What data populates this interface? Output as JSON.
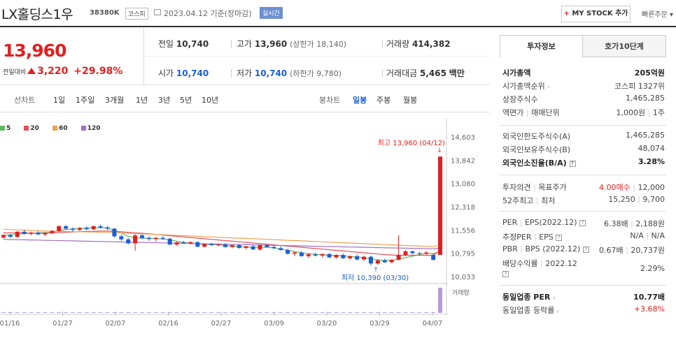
{
  "header": {
    "title": "LX홀딩스1우",
    "code": "38380K",
    "market": "코스피",
    "date_text": "2023.04.12  기준(장마감)",
    "realtime": "실시간",
    "my_stock": "MY STOCK 추가",
    "my_stock_plus": "+",
    "quick_order": "빠른주문"
  },
  "quote": {
    "price": "13,960",
    "change_label": "전일대비",
    "change": "3,220",
    "change_pct": "+29.98%",
    "prev_close_label": "전일",
    "prev_close": "10,740",
    "high_label": "고가",
    "high": "13,960",
    "high_sub": "(상한가 18,140)",
    "volume_label": "거래량",
    "volume": "414,382",
    "open_label": "시가",
    "open": "10,740",
    "low_label": "저가",
    "low": "10,740",
    "low_sub": "(하한가 9,780)",
    "amount_label": "거래대금",
    "amount": "5,465",
    "amount_unit": "백만"
  },
  "periods": {
    "line": "선차트",
    "d1": "1일",
    "w1": "1주일",
    "m3": "3개월",
    "y1": "1년",
    "y3": "3년",
    "y5": "5년",
    "y10": "10년",
    "candle": "봉차트",
    "daily": "일봉",
    "weekly": "주봉",
    "monthly": "월봉"
  },
  "legend": {
    "ma5": "5",
    "ma20": "20",
    "ma60": "60",
    "ma120": "120"
  },
  "colors": {
    "ma5": "#5fb85f",
    "ma20": "#e0505a",
    "ma60": "#f0a050",
    "ma120": "#a070c0",
    "up": "#e02020",
    "down": "#1a5fd6"
  },
  "chart_data": {
    "type": "candlestick",
    "x_ticks": [
      "01/16",
      "01/27",
      "02/07",
      "02/16",
      "02/27",
      "03/09",
      "03/20",
      "03/29",
      "04/07"
    ],
    "y_ticks": [
      "14,603",
      "13,842",
      "13,080",
      "12,318",
      "11,556",
      "10,795",
      "10,033"
    ],
    "ylim": [
      10033,
      14603
    ],
    "high_note": "최고 13,960 (04/12)",
    "low_note": "최저 10,390 (03/30)",
    "volume_label": "거래량",
    "candles": [
      [
        11310,
        11420,
        11280,
        11390
      ],
      [
        11390,
        11420,
        11300,
        11330
      ],
      [
        11330,
        11520,
        11300,
        11500
      ],
      [
        11500,
        11560,
        11400,
        11430
      ],
      [
        11430,
        11500,
        11380,
        11470
      ],
      [
        11470,
        11520,
        11400,
        11410
      ],
      [
        11410,
        11480,
        11350,
        11460
      ],
      [
        11460,
        11560,
        11420,
        11520
      ],
      [
        11520,
        11720,
        11500,
        11680
      ],
      [
        11680,
        11720,
        11560,
        11600
      ],
      [
        11600,
        11640,
        11500,
        11560
      ],
      [
        11560,
        11660,
        11520,
        11620
      ],
      [
        11620,
        11680,
        11560,
        11580
      ],
      [
        11580,
        11700,
        11560,
        11680
      ],
      [
        11680,
        11740,
        11600,
        11640
      ],
      [
        11640,
        11690,
        11550,
        11600
      ],
      [
        11600,
        11620,
        11300,
        11350
      ],
      [
        11350,
        11400,
        11200,
        11250
      ],
      [
        11250,
        11300,
        11080,
        11120
      ],
      [
        11120,
        11420,
        10880,
        11380
      ],
      [
        11380,
        11420,
        11250,
        11300
      ],
      [
        11300,
        11350,
        11200,
        11260
      ],
      [
        11260,
        11320,
        11180,
        11300
      ],
      [
        11300,
        11350,
        11240,
        11270
      ],
      [
        11270,
        11300,
        11060,
        11080
      ],
      [
        11080,
        11180,
        11040,
        11150
      ],
      [
        11150,
        11200,
        11100,
        11120
      ],
      [
        11120,
        11180,
        11080,
        11160
      ],
      [
        11160,
        11180,
        10990,
        11010
      ],
      [
        11010,
        11120,
        10980,
        11100
      ],
      [
        11100,
        11140,
        11040,
        11060
      ],
      [
        11060,
        11120,
        11020,
        11080
      ],
      [
        11080,
        11120,
        10980,
        11000
      ],
      [
        11000,
        11080,
        10960,
        11060
      ],
      [
        11060,
        11100,
        10940,
        10970
      ],
      [
        10970,
        11040,
        10920,
        11020
      ],
      [
        11020,
        11060,
        10900,
        10920
      ],
      [
        10920,
        11080,
        10880,
        11060
      ],
      [
        11060,
        11100,
        10980,
        11000
      ],
      [
        11000,
        11050,
        10930,
        10960
      ],
      [
        10960,
        11020,
        10880,
        10900
      ],
      [
        10900,
        10940,
        10750,
        10780
      ],
      [
        10780,
        10850,
        10700,
        10820
      ],
      [
        10820,
        10860,
        10680,
        10700
      ],
      [
        10700,
        10800,
        10650,
        10760
      ],
      [
        10760,
        10820,
        10690,
        10720
      ],
      [
        10720,
        10790,
        10660,
        10770
      ],
      [
        10770,
        10800,
        10640,
        10660
      ],
      [
        10660,
        10760,
        10620,
        10740
      ],
      [
        10740,
        10780,
        10610,
        10630
      ],
      [
        10630,
        10720,
        10580,
        10700
      ],
      [
        10700,
        10760,
        10560,
        10590
      ],
      [
        10590,
        10720,
        10550,
        10680
      ],
      [
        10680,
        10720,
        10390,
        10460
      ],
      [
        10460,
        10600,
        10420,
        10560
      ],
      [
        10560,
        10620,
        10480,
        10500
      ],
      [
        10500,
        10600,
        10470,
        10580
      ],
      [
        10580,
        11380,
        10560,
        10740
      ],
      [
        10740,
        10900,
        10700,
        10860
      ],
      [
        10860,
        10880,
        10760,
        10800
      ],
      [
        10800,
        10840,
        10720,
        10780
      ],
      [
        10780,
        10860,
        10740,
        10820
      ],
      [
        10740,
        10800,
        10560,
        10580
      ],
      [
        10740,
        13960,
        10740,
        13960
      ]
    ],
    "volumes": [
      1,
      1,
      1,
      1,
      1,
      1,
      1,
      1,
      1,
      1,
      1,
      1,
      1,
      1,
      1,
      1,
      1,
      1,
      1,
      1,
      1,
      1,
      1,
      1,
      1,
      1,
      1,
      1,
      1,
      1,
      1,
      1,
      1,
      1,
      1,
      1,
      1,
      1,
      1,
      1,
      1,
      1,
      1,
      1,
      1,
      1,
      1,
      1,
      1,
      1,
      1,
      1,
      1,
      1,
      1,
      1,
      1,
      1,
      1,
      1,
      1,
      1,
      1,
      40
    ],
    "ma_series": [
      {
        "name": "5",
        "values": [
          11380,
          11400,
          11420,
          11440,
          11450,
          11460,
          11470,
          11480,
          11530,
          11570,
          11590,
          11610,
          11620,
          11630,
          11630,
          11620,
          11550,
          11450,
          11350,
          11300,
          11290,
          11280,
          11270,
          11260,
          11230,
          11190,
          11150,
          11120,
          11100,
          11090,
          11080,
          11070,
          11050,
          11030,
          11010,
          11000,
          10990,
          10990,
          10990,
          10970,
          10940,
          10900,
          10850,
          10810,
          10780,
          10760,
          10740,
          10730,
          10720,
          10710,
          10690,
          10670,
          10650,
          10610,
          10580,
          10560,
          10560,
          10600,
          10650,
          10700,
          10750,
          10800,
          10780,
          10850
        ]
      },
      {
        "name": "20",
        "values": [
          11460,
          11460,
          11460,
          11460,
          11450,
          11450,
          11450,
          11460,
          11470,
          11480,
          11490,
          11500,
          11510,
          11510,
          11520,
          11520,
          11510,
          11500,
          11480,
          11460,
          11450,
          11430,
          11410,
          11390,
          11370,
          11350,
          11330,
          11310,
          11290,
          11270,
          11250,
          11230,
          11210,
          11190,
          11170,
          11150,
          11130,
          11110,
          11090,
          11070,
          11050,
          11030,
          11010,
          10990,
          10970,
          10950,
          10930,
          10910,
          10890,
          10870,
          10850,
          10830,
          10810,
          10790,
          10770,
          10750,
          10740,
          10730,
          10730,
          10730,
          10730,
          10730,
          10720,
          10900
        ]
      },
      {
        "name": "60",
        "values": [
          11580,
          11570,
          11560,
          11550,
          11540,
          11530,
          11520,
          11520,
          11510,
          11510,
          11500,
          11500,
          11490,
          11490,
          11480,
          11480,
          11470,
          11460,
          11450,
          11440,
          11430,
          11420,
          11410,
          11400,
          11390,
          11380,
          11370,
          11360,
          11350,
          11340,
          11330,
          11320,
          11310,
          11300,
          11290,
          11280,
          11270,
          11260,
          11250,
          11240,
          11230,
          11220,
          11210,
          11200,
          11190,
          11180,
          11170,
          11160,
          11150,
          11140,
          11130,
          11120,
          11110,
          11100,
          11090,
          11080,
          11070,
          11060,
          11050,
          11040,
          11030,
          11020,
          11010,
          11060
        ]
      },
      {
        "name": "120",
        "values": [
          11250,
          11245,
          11240,
          11235,
          11230,
          11225,
          11220,
          11215,
          11210,
          11205,
          11200,
          11195,
          11190,
          11185,
          11180,
          11175,
          11170,
          11165,
          11160,
          11155,
          11150,
          11145,
          11140,
          11135,
          11130,
          11125,
          11120,
          11115,
          11110,
          11105,
          11100,
          11095,
          11090,
          11085,
          11080,
          11075,
          11070,
          11065,
          11060,
          11055,
          11050,
          11045,
          11040,
          11035,
          11030,
          11025,
          11020,
          11015,
          11010,
          11005,
          11000,
          10995,
          10990,
          10985,
          10980,
          10975,
          10970,
          10965,
          10960,
          10955,
          10950,
          10945,
          10940,
          10960
        ]
      }
    ]
  },
  "side": {
    "tab_invest": "투자정보",
    "tab_hoga": "호가10단계",
    "market_cap_label": "시가총액",
    "market_cap": "205억원",
    "market_cap_rank_label": "시가총액순위",
    "market_cap_rank": "코스피 1327위",
    "shares_label": "상장주식수",
    "shares": "1,465,285",
    "par_label": "액면가",
    "unit_label": "매매단위",
    "par": "1,000원",
    "unit": "1주",
    "foreign_limit_label": "외국인한도주식수(A)",
    "foreign_limit": "1,465,285",
    "foreign_hold_label": "외국인보유주식수(B)",
    "foreign_hold": "48,074",
    "foreign_rate_label": "외국인소진율(B/A)",
    "foreign_rate": "3.28%",
    "opinion_label": "투자의견",
    "target_label": "목표주가",
    "opinion": "4.00매수",
    "target": "12,000",
    "w52_label": "52주최고",
    "w52_low_label": "최저",
    "w52_high": "15,250",
    "w52_low": "9,700",
    "per_label": "PER",
    "eps_label": "EPS(2022.12)",
    "per": "6.38배",
    "eps": "2,188원",
    "est_per_label": "추정PER",
    "est_eps_label": "EPS",
    "est_per": "N/A",
    "est_eps": "N/A",
    "pbr_label": "PBR",
    "bps_label": "BPS (2022.12)",
    "pbr": "0.67배",
    "bps": "20,737원",
    "div_label": "배당수익률",
    "div_date": "2022.12",
    "div": "2.29%",
    "ind_per_label": "동일업종 PER",
    "ind_per": "10.77배",
    "ind_rate_label": "동일업종 등락률",
    "ind_rate": "+3.68%"
  }
}
